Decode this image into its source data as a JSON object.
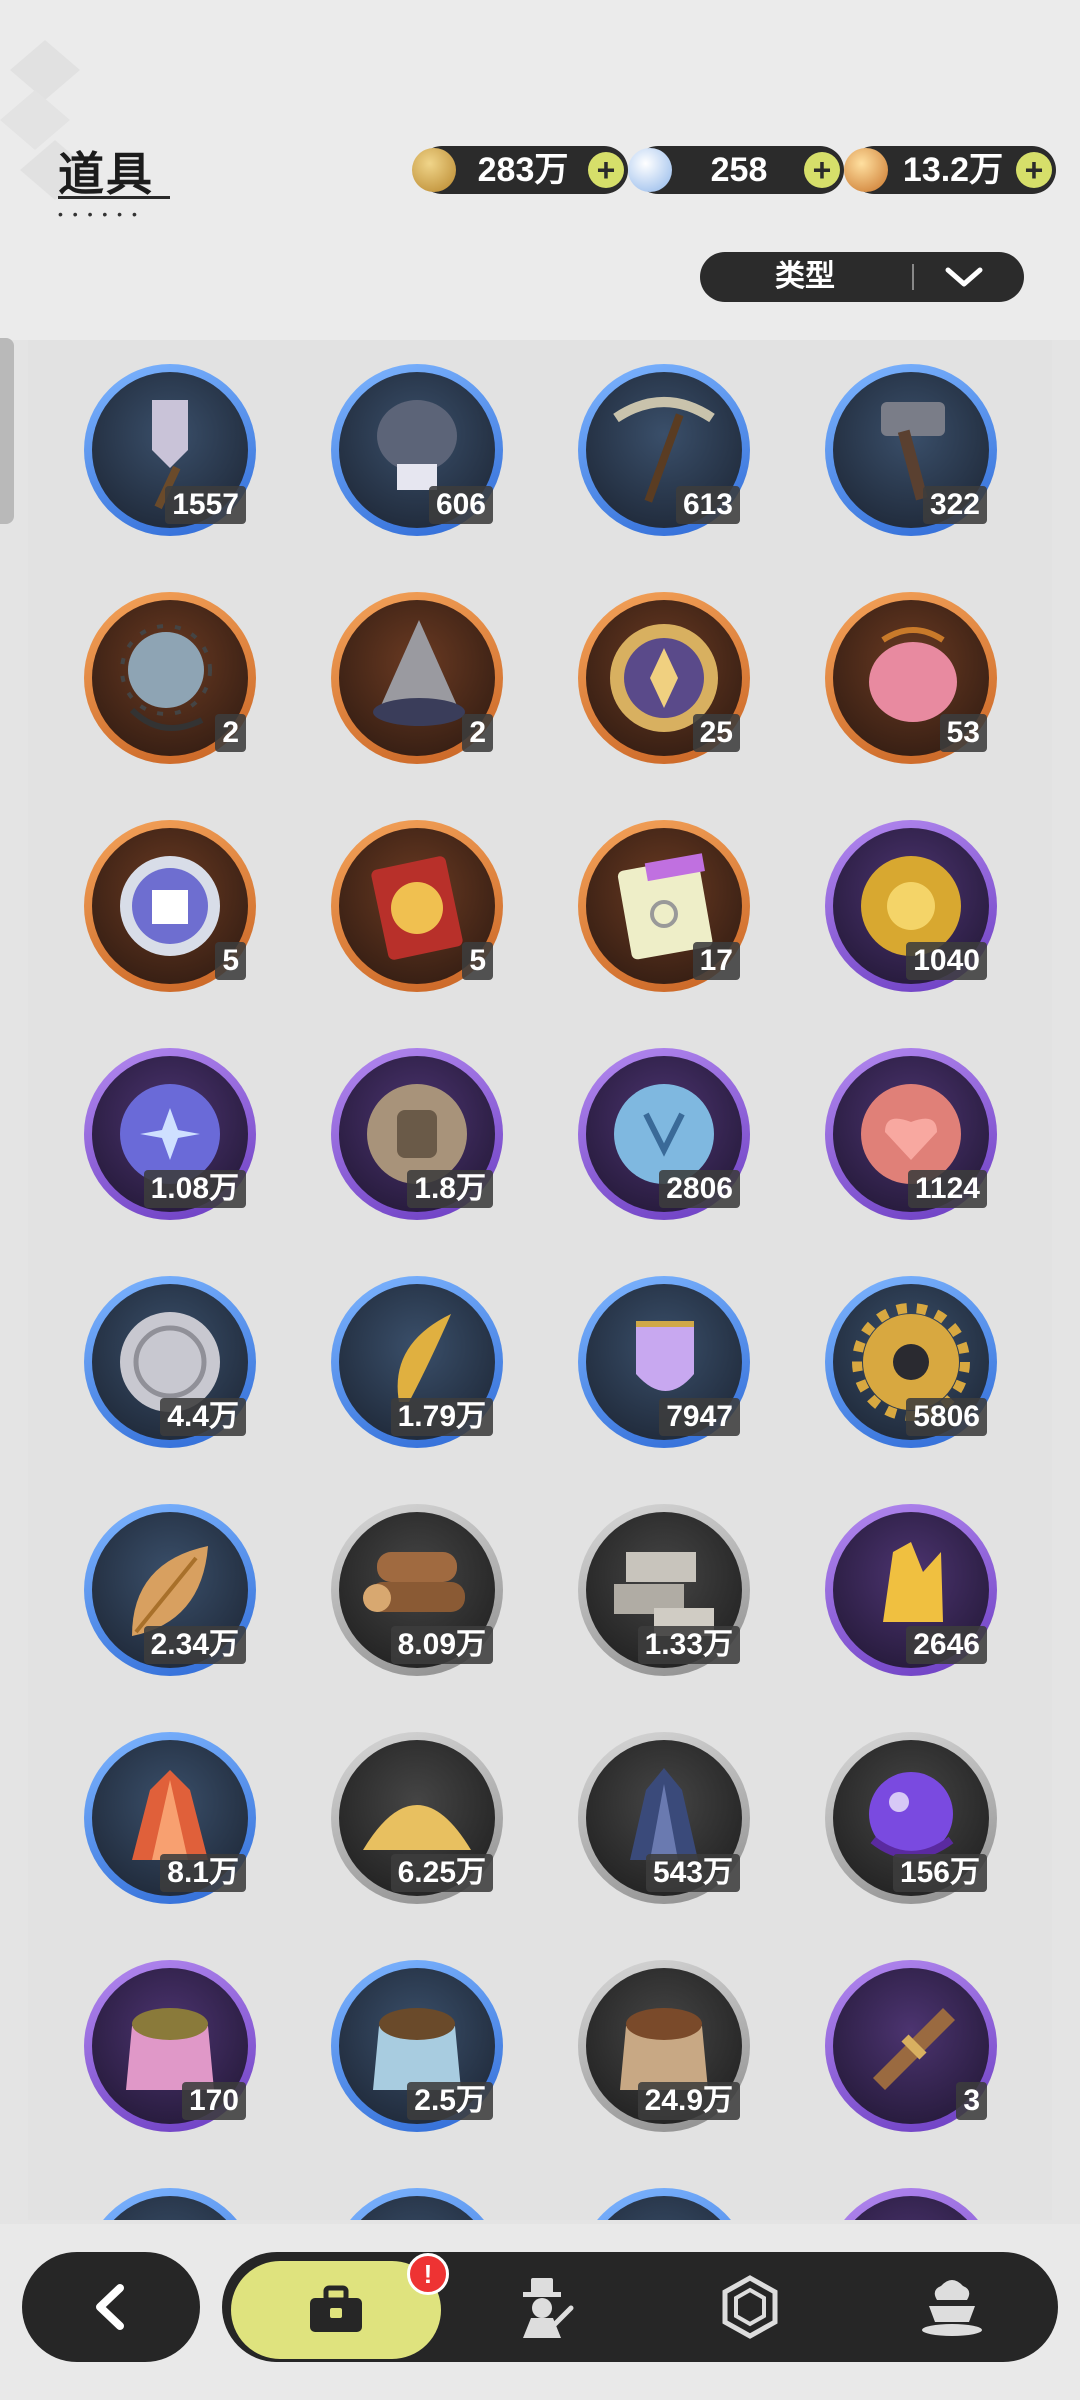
{
  "header": {
    "title": "道具"
  },
  "currencies": [
    {
      "value": "283万",
      "icon": "gold-coin-icon",
      "color": "#c7a24a"
    },
    {
      "value": "258",
      "icon": "crystal-flower-icon",
      "color": "#a8c6f0"
    },
    {
      "value": "13.2万",
      "icon": "star-shard-icon",
      "color": "#e0a050"
    }
  ],
  "filter": {
    "label": "类型"
  },
  "items": [
    {
      "count": "1557",
      "rarity": "blue",
      "icon": "shovel-icon"
    },
    {
      "count": "606",
      "rarity": "blue",
      "icon": "gauntlet-icon"
    },
    {
      "count": "613",
      "rarity": "blue",
      "icon": "pickaxe-icon"
    },
    {
      "count": "322",
      "rarity": "blue",
      "icon": "hammer-icon"
    },
    {
      "count": "2",
      "rarity": "orange",
      "icon": "spiked-ball-icon"
    },
    {
      "count": "2",
      "rarity": "orange",
      "icon": "drill-icon"
    },
    {
      "count": "25",
      "rarity": "orange",
      "icon": "emblem-icon"
    },
    {
      "count": "53",
      "rarity": "orange",
      "icon": "pink-gem-icon"
    },
    {
      "count": "5",
      "rarity": "orange",
      "icon": "outfit-coin-icon"
    },
    {
      "count": "5",
      "rarity": "orange",
      "icon": "wheel-ticket-icon"
    },
    {
      "count": "17",
      "rarity": "orange",
      "icon": "rainbow-ticket-icon"
    },
    {
      "count": "1040",
      "rarity": "purple",
      "icon": "gold-flower-coin-icon"
    },
    {
      "count": "1.08万",
      "rarity": "purple",
      "icon": "moon-star-coin-icon"
    },
    {
      "count": "1.8万",
      "rarity": "purple",
      "icon": "fist-coin-icon"
    },
    {
      "count": "2806",
      "rarity": "purple",
      "icon": "blue-crest-coin-icon"
    },
    {
      "count": "1124",
      "rarity": "purple",
      "icon": "heart-coin-icon"
    },
    {
      "count": "4.4万",
      "rarity": "blue",
      "icon": "silver-coin-icon"
    },
    {
      "count": "1.79万",
      "rarity": "blue",
      "icon": "golden-claw-icon"
    },
    {
      "count": "7947",
      "rarity": "blue",
      "icon": "scale-shield-icon"
    },
    {
      "count": "5806",
      "rarity": "blue",
      "icon": "gear-icon"
    },
    {
      "count": "2.34万",
      "rarity": "blue",
      "icon": "leaf-icon"
    },
    {
      "count": "8.09万",
      "rarity": "gray",
      "icon": "logs-icon"
    },
    {
      "count": "1.33万",
      "rarity": "gray",
      "icon": "stone-bricks-icon"
    },
    {
      "count": "2646",
      "rarity": "purple",
      "icon": "gold-crystal-icon"
    },
    {
      "count": "8.1万",
      "rarity": "blue",
      "icon": "fire-crystal-icon"
    },
    {
      "count": "6.25万",
      "rarity": "gray",
      "icon": "sand-pile-icon"
    },
    {
      "count": "543万",
      "rarity": "gray",
      "icon": "dark-crystal-icon"
    },
    {
      "count": "156万",
      "rarity": "gray",
      "icon": "magic-orb-icon"
    },
    {
      "count": "170",
      "rarity": "purple",
      "icon": "pink-food-bag-icon"
    },
    {
      "count": "2.5万",
      "rarity": "blue",
      "icon": "blue-food-bag-icon"
    },
    {
      "count": "24.9万",
      "rarity": "gray",
      "icon": "brown-food-bag-icon"
    },
    {
      "count": "3",
      "rarity": "purple",
      "icon": "bundle-icon"
    }
  ],
  "bottom_nav": {
    "alert": "!",
    "tabs": [
      {
        "icon": "briefcase-icon",
        "active": true
      },
      {
        "icon": "costume-icon",
        "active": false
      },
      {
        "icon": "hexagon-gem-icon",
        "active": false
      },
      {
        "icon": "dessert-icon",
        "active": false
      }
    ]
  }
}
